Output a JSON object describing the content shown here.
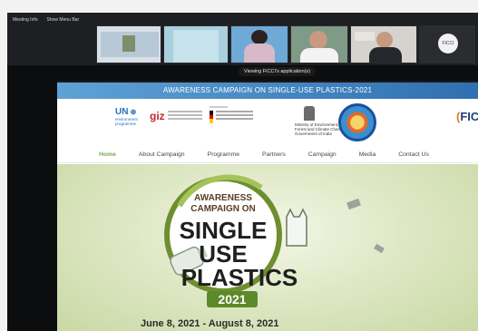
{
  "zoom": {
    "meeting_info": "Meeting Info",
    "show_menu_bar": "Show Menu Bar",
    "viewing_banner": "Viewing FICCI's application(s)",
    "ficci_tile": "FICCI"
  },
  "site": {
    "title": "AWARENESS CAMPAIGN ON SINGLE-USE PLASTICS-2021",
    "nav": [
      "Home",
      "About Campaign",
      "Programme",
      "Partners",
      "Campaign",
      "Media",
      "Contact Us"
    ],
    "unep_line1": "UN",
    "unep_line2": "environment",
    "unep_line3": "programme",
    "giz": "giz",
    "moef_line1": "Ministry of Environment,",
    "moef_line2": "Forest and Climate Change",
    "moef_line3": "Government of India",
    "ficci_partial": "FICCI",
    "hero_line1": "AWARENESS",
    "hero_line2": "CAMPAIGN ON",
    "hero_single": "SINGLE",
    "hero_use": "USE",
    "hero_plastics": "PLASTICS",
    "hero_year": "2021",
    "dates": "June 8, 2021 - August 8, 2021"
  },
  "colors": {
    "banner_blue": "#2f6fb0",
    "nav_active_green": "#7aa648",
    "badge_green": "#6d8f2f",
    "year_bg": "#5c8a2a"
  }
}
